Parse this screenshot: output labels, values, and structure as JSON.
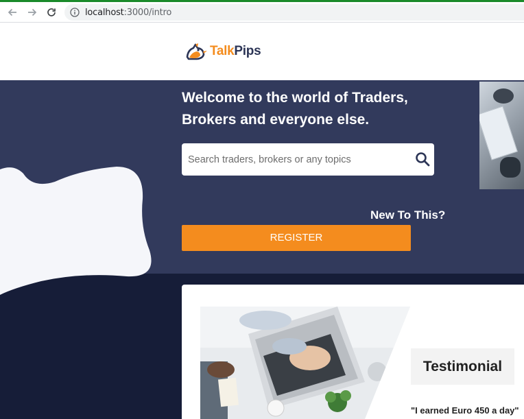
{
  "browser": {
    "url_host": "localhost",
    "url_path": ":3000/intro",
    "back_icon": "arrow-left-icon",
    "forward_icon": "arrow-right-icon",
    "reload_icon": "reload-icon",
    "info_icon": "info-icon"
  },
  "brand": {
    "logo_part1": "Talk",
    "logo_part2": "Pips",
    "accent_color": "#f48c1e",
    "navy_color": "#2c3556"
  },
  "hero": {
    "headline_line1": "Welcome to the world of Traders,",
    "headline_line2": "Brokers and everyone else.",
    "search_placeholder": "Search traders, brokers or any topics",
    "new_to_this": "New To This?",
    "register_label": "REGISTER",
    "background_color": "#323a5c"
  },
  "testimonial": {
    "title": "Testimonial",
    "quote": "\"I earned Euro 450 a day\""
  }
}
